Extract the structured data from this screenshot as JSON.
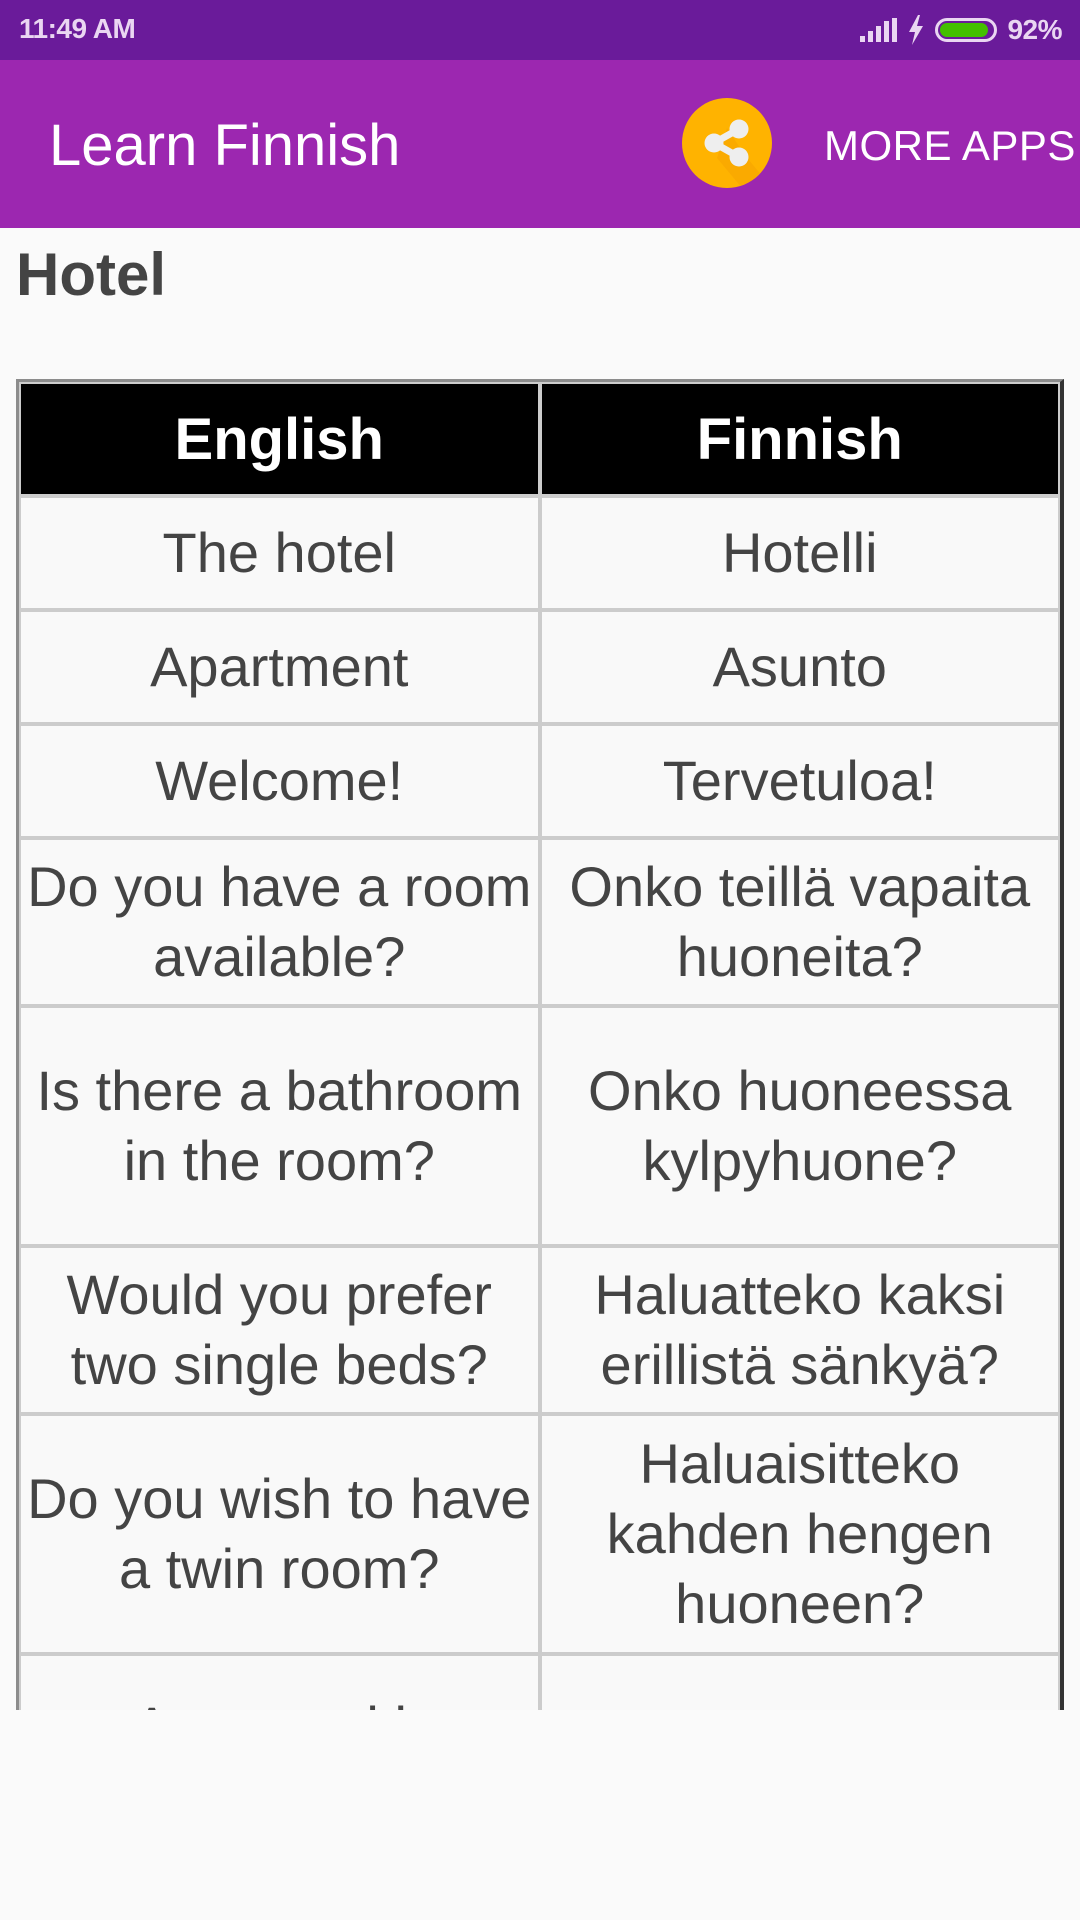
{
  "status_bar": {
    "time": "11:49 AM",
    "battery_percent": "92%",
    "battery_level": 0.92,
    "icons": [
      "signal-icon",
      "charging-bolt-icon",
      "battery-icon"
    ]
  },
  "app_bar": {
    "title": "Learn Finnish",
    "share_icon": "share-icon",
    "share_color": "#FFB300",
    "more_apps_label": "MORE APPS",
    "color": "#9C27B0"
  },
  "page": {
    "title": "Hotel"
  },
  "table": {
    "headers": [
      "English",
      "Finnish"
    ],
    "rows": [
      [
        "The hotel",
        "Hotelli"
      ],
      [
        "Apartment",
        "Asunto"
      ],
      [
        "Welcome!",
        "Tervetuloa!"
      ],
      [
        "Do you have a room available?",
        "Onko teillä vapaita huoneita?"
      ],
      [
        "Is there a bathroom in the room?",
        "Onko huoneessa kylpyhuone?"
      ],
      [
        "Would you prefer two single beds?",
        "Haluatteko kaksi erillistä sänkyä?"
      ],
      [
        "Do you wish to have a twin room?",
        "Haluaisitteko kahden hengen huoneen?"
      ],
      [
        "A room with",
        ""
      ]
    ]
  }
}
